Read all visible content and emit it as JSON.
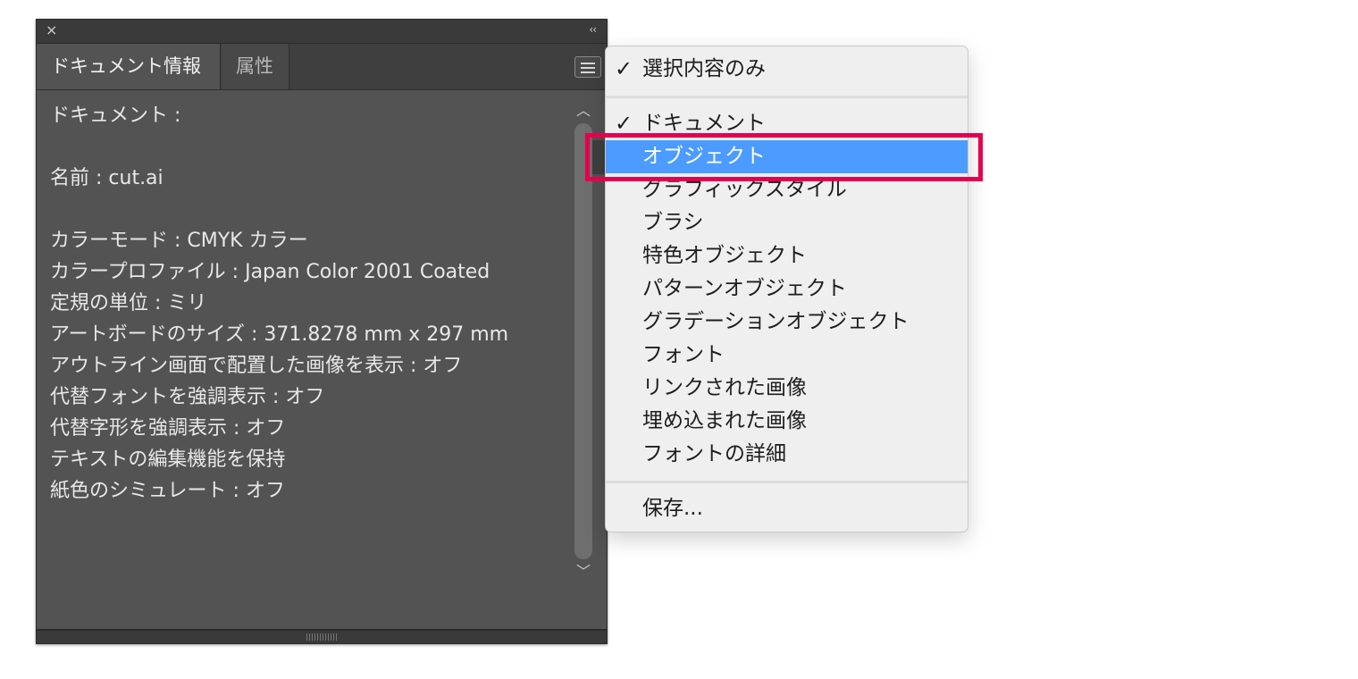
{
  "panel": {
    "close_glyph": "×",
    "collapse_glyph": "‹‹",
    "tabs": [
      {
        "label": "ドキュメント情報",
        "active": true
      },
      {
        "label": "属性",
        "active": false
      }
    ],
    "lines": [
      "ドキュメント :",
      "",
      "名前 : cut.ai",
      "",
      "カラーモード : CMYK カラー",
      "カラープロファイル : Japan Color 2001 Coated",
      "定規の単位 : ミリ",
      "アートボードのサイズ : 371.8278 mm x 297 mm",
      "アウトライン画面で配置した画像を表示 : オフ",
      "代替フォントを強調表示 : オフ",
      "代替字形を強調表示 : オフ",
      "テキストの編集機能を保持",
      "紙色のシミュレート : オフ"
    ]
  },
  "menu": {
    "items": [
      {
        "label": "選択内容のみ",
        "checked": true
      },
      {
        "label": "ドキュメント",
        "checked": true
      },
      {
        "label": "オブジェクト",
        "checked": false,
        "highlighted": true
      },
      {
        "label": "グラフィックスタイル",
        "checked": false
      },
      {
        "label": "ブラシ",
        "checked": false
      },
      {
        "label": "特色オブジェクト",
        "checked": false
      },
      {
        "label": "パターンオブジェクト",
        "checked": false
      },
      {
        "label": "グラデーションオブジェクト",
        "checked": false
      },
      {
        "label": "フォント",
        "checked": false
      },
      {
        "label": "リンクされた画像",
        "checked": false
      },
      {
        "label": "埋め込まれた画像",
        "checked": false
      },
      {
        "label": "フォントの詳細",
        "checked": false
      },
      {
        "label": "保存...",
        "checked": false
      }
    ],
    "check_glyph": "✓"
  },
  "colors": {
    "highlight": "#4c9bff",
    "annotation": "#e5004f",
    "panel_bg": "#535353"
  }
}
